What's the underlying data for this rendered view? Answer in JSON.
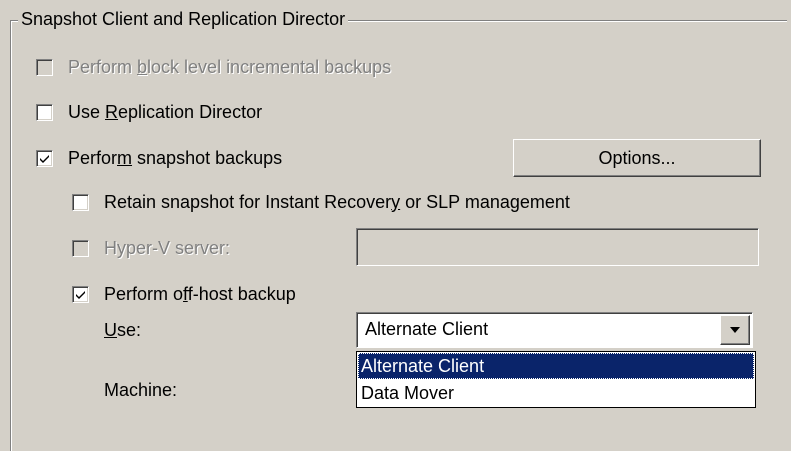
{
  "group": {
    "title": "Snapshot Client and Replication Director"
  },
  "options": {
    "block_level": {
      "label_pre": "Perform ",
      "label_accel": "b",
      "label_post": "lock level incremental backups",
      "checked": false,
      "enabled": false
    },
    "replication_director": {
      "label_pre": "Use ",
      "label_accel": "R",
      "label_post": "eplication Director",
      "checked": false,
      "enabled": true
    },
    "snapshot_backups": {
      "label_pre": "Perfor",
      "label_accel": "m",
      "label_post": " snapshot backups",
      "checked": true,
      "enabled": true
    },
    "options_button": "Options...",
    "retain_snapshot": {
      "label_pre": "Retain snapshot for Instant Recover",
      "label_accel": "y",
      "label_post": " or SLP management",
      "checked": false,
      "enabled": true
    },
    "hyperv_server": {
      "label": "Hyper-V server:",
      "checked": false,
      "enabled": false,
      "value": ""
    },
    "offhost_backup": {
      "label_pre": "Perform o",
      "label_accel": "f",
      "label_post": "f-host backup",
      "checked": true,
      "enabled": true
    }
  },
  "use": {
    "label_accel": "U",
    "label_post": "se:",
    "selected": "Alternate Client",
    "dropdown_items": [
      "Alternate Client",
      "Data Mover"
    ]
  },
  "machine": {
    "label": "Machine:"
  },
  "colors": {
    "background": "#d4d0c8",
    "selection": "#0a246a",
    "disabled_text": "#808080"
  }
}
